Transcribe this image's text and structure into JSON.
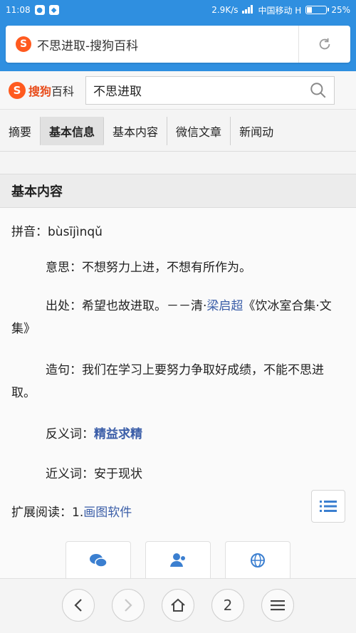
{
  "status_bar": {
    "time": "11:08",
    "left_icons": [
      "notification-icon",
      "app-icon"
    ],
    "speed": "2.9K/s",
    "carrier": "中国移动 H",
    "battery": "25%",
    "battery_level": 0.25
  },
  "browser": {
    "url_title": "不思进取-搜狗百科",
    "reload_icon": "reload-icon",
    "tab_count": "2"
  },
  "site": {
    "brand_logo": "S",
    "brand_name_bold": "搜狗",
    "brand_name_rest": "百科",
    "search_value": "不思进取"
  },
  "tabs": [
    {
      "label": "摘要",
      "active": false
    },
    {
      "label": "基本信息",
      "active": true
    },
    {
      "label": "基本内容",
      "active": false
    },
    {
      "label": "微信文章",
      "active": false
    },
    {
      "label": "新闻动",
      "active": false
    }
  ],
  "section": {
    "title": "基本内容"
  },
  "content": {
    "pinyin_label": "拼音：",
    "pinyin_value": "bùsījìnqǔ",
    "meaning_label": "意思：",
    "meaning_text": "不想努力上进，不想有所作为。",
    "source_label": "出处：",
    "source_text": "希望也故进取。－－清·",
    "source_author": "梁启超",
    "source_book": "《饮冰室合集·文集》",
    "example_label": "造句：",
    "example_text": "我们在学习上要努力争取好成绩，不能不思进取。",
    "antonym_label": "反义词：",
    "antonym_value": "精益求精",
    "synonym_label": "近义词：",
    "synonym_value": "安于现状",
    "extended_label": "扩展阅读：",
    "extended_num": "1.",
    "extended_link": "画图软件"
  }
}
